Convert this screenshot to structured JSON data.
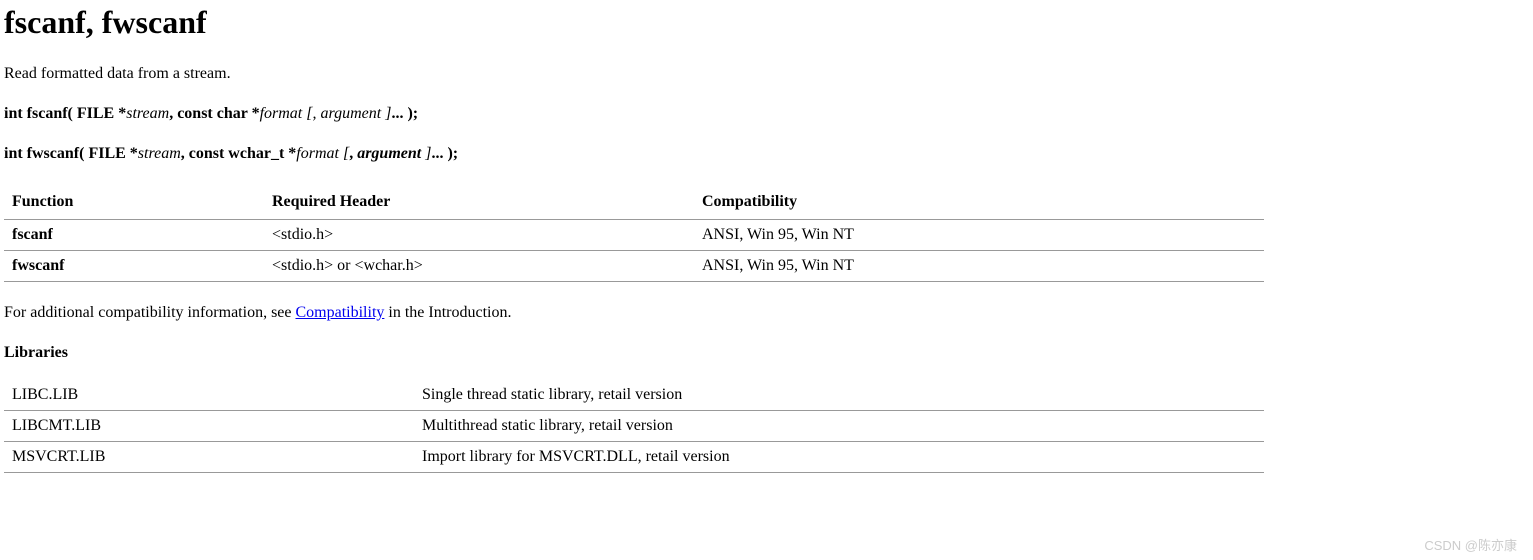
{
  "title": "fscanf, fwscanf",
  "description": "Read formatted data from a stream.",
  "signature1": {
    "prefix": "int fscanf( FILE *",
    "param1": "stream",
    "mid1": ", const char *",
    "param2": "format ",
    "opt_open": "[",
    "opt_sep": ", ",
    "param3": "argument ",
    "opt_close": "]",
    "suffix": "... );"
  },
  "signature2": {
    "prefix": "int fwscanf( FILE *",
    "param1": "stream",
    "mid1": ", const wchar_t *",
    "param2": "format ",
    "opt_open": "[",
    "opt_sep": ", ",
    "param3": "argument ",
    "opt_close": "]",
    "suffix": "... );"
  },
  "table1": {
    "headers": {
      "function": "Function",
      "required_header": "Required Header",
      "compatibility": "Compatibility"
    },
    "rows": [
      {
        "function": "fscanf",
        "required_header": "<stdio.h>",
        "compatibility": "ANSI, Win 95, Win NT"
      },
      {
        "function": "fwscanf",
        "required_header": "<stdio.h> or <wchar.h>",
        "compatibility": "ANSI, Win 95, Win NT"
      }
    ]
  },
  "compat_text": {
    "before": "For additional compatibility information, see ",
    "link": "Compatibility",
    "after": " in the Introduction."
  },
  "libraries_heading": "Libraries",
  "table2": {
    "rows": [
      {
        "lib": "LIBC.LIB",
        "desc": "Single thread static library, retail version"
      },
      {
        "lib": "LIBCMT.LIB",
        "desc": "Multithread static library, retail version"
      },
      {
        "lib": "MSVCRT.LIB",
        "desc": "Import library for MSVCRT.DLL, retail version"
      }
    ]
  },
  "watermark": "CSDN @陈亦康"
}
